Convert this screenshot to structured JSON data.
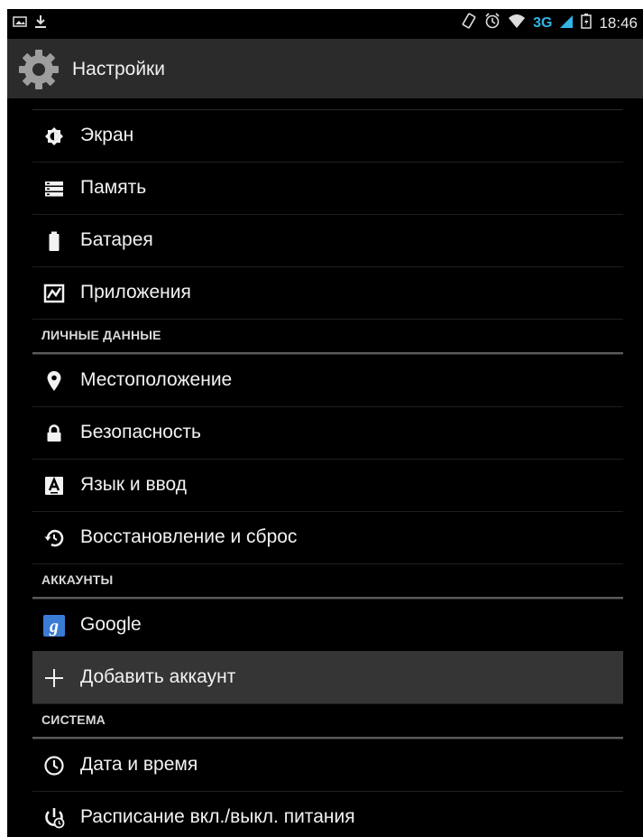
{
  "status_bar": {
    "time": "18:46",
    "network": "3G",
    "left_icons": [
      "image-notification-icon",
      "download-icon"
    ],
    "right_icons": [
      "screen-rotate-icon",
      "alarm-icon",
      "wifi-icon",
      "signal-icon",
      "battery-icon"
    ]
  },
  "action_bar": {
    "title": "Настройки",
    "icon": "settings-gear-icon"
  },
  "groups": {
    "device_items": [
      {
        "label": "Экран",
        "icon": "brightness-icon"
      },
      {
        "label": "Память",
        "icon": "storage-icon"
      },
      {
        "label": "Батарея",
        "icon": "battery-icon"
      },
      {
        "label": "Приложения",
        "icon": "apps-icon"
      }
    ],
    "personal": {
      "header": "ЛИЧНЫЕ ДАННЫЕ",
      "items": [
        {
          "label": "Местоположение",
          "icon": "location-pin-icon"
        },
        {
          "label": "Безопасность",
          "icon": "lock-icon"
        },
        {
          "label": "Язык и ввод",
          "icon": "keyboard-language-icon"
        },
        {
          "label": "Восстановление и сброс",
          "icon": "backup-restore-icon"
        }
      ]
    },
    "accounts": {
      "header": "АККАУНТЫ",
      "items": [
        {
          "label": "Google",
          "icon": "google-icon"
        },
        {
          "label": "Добавить аккаунт",
          "icon": "plus-icon"
        }
      ]
    },
    "system": {
      "header": "СИСТЕМА",
      "items": [
        {
          "label": "Дата и время",
          "icon": "clock-icon"
        },
        {
          "label": "Расписание вкл./выкл. питания",
          "icon": "power-schedule-icon"
        }
      ]
    }
  },
  "colors": {
    "background": "#000000",
    "action_bar": "#2b2b2b",
    "accent": "#33b5e5",
    "pressed_row": "#353535"
  }
}
